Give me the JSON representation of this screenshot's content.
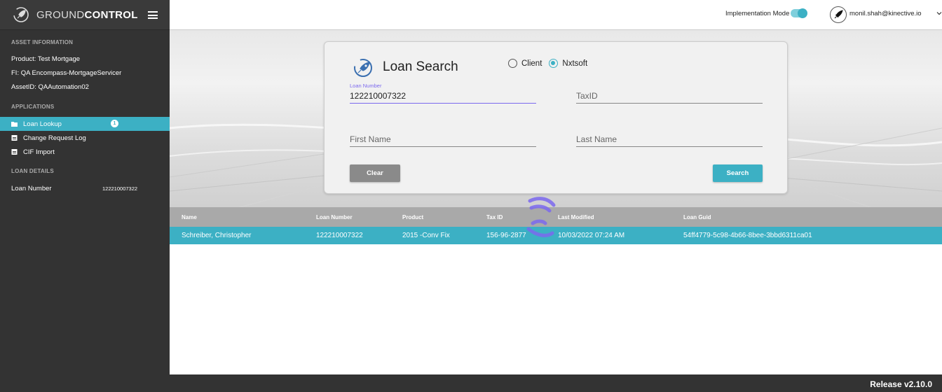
{
  "brand": {
    "name_light": "GROUND",
    "name_bold": "CONTROL"
  },
  "header": {
    "implementation_mode_label": "Implementation Mode",
    "implementation_mode_on": true,
    "user_email": "monil.shah@kinective.io"
  },
  "sidebar": {
    "asset_information_heading": "ASSET INFORMATION",
    "asset_info": [
      {
        "text": "Product:  Test Mortgage"
      },
      {
        "text": "FI:  QA Encompass-MortgageServicer"
      },
      {
        "text": "AssetID:  QAAutomation02"
      }
    ],
    "applications_heading": "APPLICATIONS",
    "applications": [
      {
        "label": "Loan Lookup",
        "icon": "folder-icon",
        "active": true,
        "badge": "1"
      },
      {
        "label": "Change Request Log",
        "icon": "clipboard-icon",
        "active": false
      },
      {
        "label": "CIF Import",
        "icon": "clipboard-icon",
        "active": false
      }
    ],
    "loan_details_heading": "LOAN DETAILS",
    "loan_details": {
      "label": "Loan Number",
      "value": "122210007322"
    }
  },
  "search_card": {
    "title": "Loan Search",
    "radio_options": [
      {
        "label": "Client",
        "checked": false
      },
      {
        "label": "Nxtsoft",
        "checked": true
      }
    ],
    "loan_number": {
      "label": "Loan Number",
      "value": "122210007322"
    },
    "tax_id": {
      "placeholder": "TaxID",
      "value": ""
    },
    "first_name": {
      "placeholder": "First Name",
      "value": ""
    },
    "last_name": {
      "placeholder": "Last Name",
      "value": ""
    },
    "clear_label": "Clear",
    "search_label": "Search"
  },
  "results": {
    "columns": [
      "Name",
      "Loan Number",
      "Product",
      "Tax ID",
      "Last Modified",
      "Loan Guid"
    ],
    "rows": [
      [
        "Schreiber, Christopher",
        "122210007322",
        "2015 -Conv Fix",
        "156-96-2877",
        "10/03/2022 07:24 AM",
        "54ff4779-5c98-4b66-8bee-3bbd6311ca01"
      ]
    ]
  },
  "footer": {
    "release": "Release v2.10.0"
  },
  "colors": {
    "accent": "#3cb0c4",
    "sidebar_bg": "#333333",
    "focus": "#7b68ee",
    "loader": "#7b68ee"
  }
}
